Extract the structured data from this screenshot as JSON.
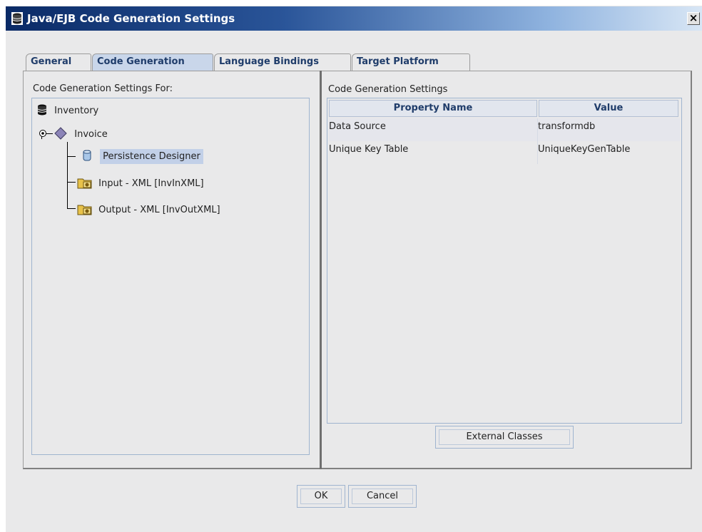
{
  "window": {
    "title": "Java/EJB Code Generation Settings",
    "close_symbol": "×",
    "icons": {
      "app": "database-icon",
      "close": "close-icon"
    }
  },
  "tabs": [
    {
      "label": "General",
      "active": false
    },
    {
      "label": "Code Generation",
      "active": true
    },
    {
      "label": "Language Bindings",
      "active": false
    },
    {
      "label": "Target Platform",
      "active": false
    }
  ],
  "left_panel": {
    "label": "Code Generation Settings For:",
    "tree": [
      {
        "label": "Inventory",
        "icon": "database-icon"
      },
      {
        "label": "Invoice",
        "icon": "diamond-icon"
      },
      {
        "label": "Persistence Designer",
        "icon": "cylinder-icon",
        "selected": true
      },
      {
        "label": "Input - XML [InvInXML]",
        "icon": "xml-folder-icon"
      },
      {
        "label": "Output - XML [InvOutXML]",
        "icon": "xml-folder-icon"
      }
    ]
  },
  "right_panel": {
    "label": "Code Generation Settings",
    "columns": [
      "Property Name",
      "Value"
    ],
    "rows": [
      {
        "property": "Data Source",
        "value": "transformdb"
      },
      {
        "property": "Unique Key Table",
        "value": "UniqueKeyGenTable"
      }
    ],
    "external_button": "External Classes"
  },
  "buttons": {
    "ok": "OK",
    "cancel": "Cancel"
  },
  "colors": {
    "title_start": "#0a2a66",
    "title_end": "#d8e6f5",
    "selection": "#c2d0e8",
    "accent_text": "#1f3c6a"
  }
}
